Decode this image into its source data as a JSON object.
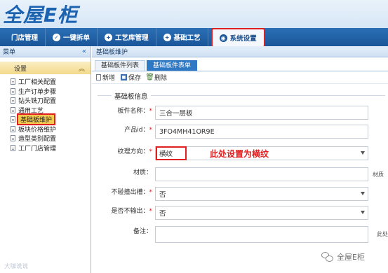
{
  "logo": {
    "text": "全屋E柜"
  },
  "nav": {
    "items": [
      {
        "label": "门店管理",
        "icon": "none"
      },
      {
        "label": "一键拆单",
        "icon": "check-circle-icon"
      },
      {
        "label": "工艺库管理",
        "icon": "plus-circle-icon"
      },
      {
        "label": "基础工艺",
        "icon": "plus-circle-icon"
      },
      {
        "label": "系统设置",
        "icon": "settings-circle-icon"
      }
    ]
  },
  "sidebar": {
    "title": "菜单",
    "group": "设置",
    "items": [
      {
        "label": "工厂相关配置"
      },
      {
        "label": "生产订单步骤"
      },
      {
        "label": "钻头铣刀配置"
      },
      {
        "label": "通用工艺"
      },
      {
        "label": "基础板维护"
      },
      {
        "label": "板块价格维护"
      },
      {
        "label": "造型类别配置"
      },
      {
        "label": "工厂门店管理"
      }
    ]
  },
  "breadcrumb": "基础板维护",
  "tabs": [
    {
      "label": "基础板件列表"
    },
    {
      "label": "基础板件表单"
    }
  ],
  "toolbar": {
    "new": "新增",
    "save": "保存",
    "delete": "删除"
  },
  "form": {
    "legend": "基础板信息",
    "fields": {
      "name": {
        "label": "板件名称：",
        "value": "三合一层板",
        "required": "*"
      },
      "product_id": {
        "label": "产品id：",
        "value": "3FO4MH41OR9E",
        "required": "*"
      },
      "grain": {
        "label": "纹理方向：",
        "value": "横纹",
        "required": "*"
      },
      "material": {
        "label": "材质：",
        "value": "",
        "side_label": "材质"
      },
      "no_slot": {
        "label": "不碰撞出槽：",
        "value": "否",
        "required": "*"
      },
      "no_output": {
        "label": "是否不输出：",
        "value": "否",
        "required": "*"
      },
      "remark": {
        "label": "备注：",
        "value": "",
        "side_label": "此处"
      }
    },
    "annotation": "此处设置为横纹"
  },
  "watermark": {
    "left": "大咖说说",
    "right": "全屋E柜"
  },
  "colors": {
    "nav": "#1a5698",
    "highlight": "#e02020",
    "selected": "#f3c94f",
    "tab_active": "#2f78c4"
  }
}
